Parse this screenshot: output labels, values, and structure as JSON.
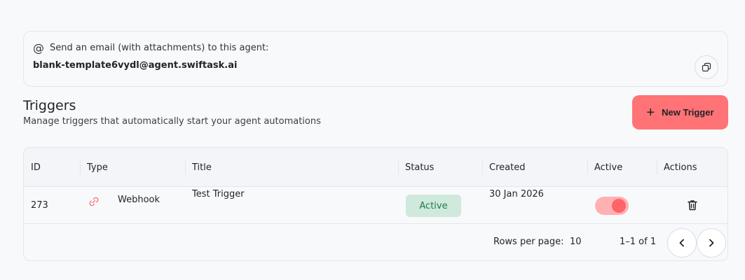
{
  "email": {
    "prompt": "Send an email (with attachments) to this agent:",
    "address": "blank-template6vydl@agent.swiftask.ai"
  },
  "triggers": {
    "title": "Triggers",
    "subtitle": "Manage triggers that automatically start your agent automations",
    "new_label": "New Trigger"
  },
  "table": {
    "headers": {
      "id": "ID",
      "type": "Type",
      "title": "Title",
      "status": "Status",
      "created": "Created",
      "active": "Active",
      "actions": "Actions"
    },
    "rows": [
      {
        "id": "273",
        "type": "Webhook",
        "title": "Test Trigger",
        "status": "Active",
        "created": "30 Jan 2026",
        "active": true
      }
    ]
  },
  "pagination": {
    "rows_label": "Rows per page:",
    "rows_value": "10",
    "range": "1–1 of 1"
  },
  "colors": {
    "accent": "#ff7275",
    "status_bg": "#cfe9dc",
    "status_fg": "#1f7a47"
  }
}
